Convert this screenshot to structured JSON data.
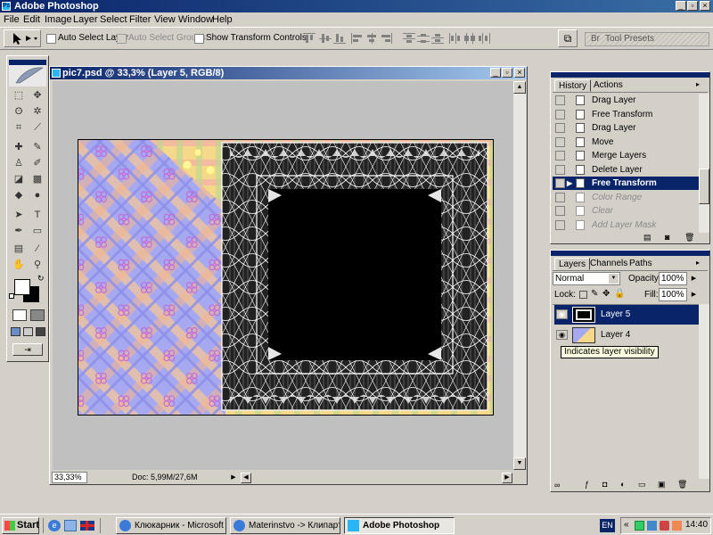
{
  "app": {
    "title": "Adobe Photoshop"
  },
  "menu": [
    "File",
    "Edit",
    "Image",
    "Layer",
    "Select",
    "Filter",
    "View",
    "Window",
    "Help"
  ],
  "options_bar": {
    "auto_select_layer": "Auto Select Layer",
    "auto_select_groups": "Auto Select Groups",
    "show_transform_controls": "Show Transform Controls",
    "tool_presets": "Tool Presets",
    "brushes_tab": "Br"
  },
  "document": {
    "title": "pic7.psd @ 33,3% (Layer 5, RGB/8)",
    "zoom": "33,33%",
    "doc_size": "Doc: 5,99M/27,6M"
  },
  "history": {
    "tabs": [
      "History",
      "Actions"
    ],
    "items": [
      {
        "label": "Drag Layer",
        "state": "normal"
      },
      {
        "label": "Free Transform",
        "state": "normal"
      },
      {
        "label": "Drag Layer",
        "state": "normal"
      },
      {
        "label": "Move",
        "state": "normal"
      },
      {
        "label": "Merge Layers",
        "state": "normal"
      },
      {
        "label": "Delete Layer",
        "state": "normal"
      },
      {
        "label": "Free Transform",
        "state": "selected"
      },
      {
        "label": "Color Range",
        "state": "dimmed"
      },
      {
        "label": "Clear",
        "state": "dimmed"
      },
      {
        "label": "Add Layer Mask",
        "state": "dimmed"
      }
    ]
  },
  "layers": {
    "tabs": [
      "Layers",
      "Channels",
      "Paths"
    ],
    "blend_mode": "Normal",
    "opacity_label": "Opacity:",
    "opacity": "100%",
    "lock_label": "Lock:",
    "fill_label": "Fill:",
    "fill": "100%",
    "items": [
      {
        "name": "Layer 5",
        "selected": true
      },
      {
        "name": "Layer 4",
        "selected": false
      }
    ],
    "tooltip": "Indicates layer visibility"
  },
  "taskbar": {
    "start": "Start",
    "buttons": [
      {
        "label": "Клюкарник - Microsoft I...",
        "active": false
      },
      {
        "label": "Materinstvo -> Клипарт...",
        "active": false
      },
      {
        "label": "Adobe Photoshop",
        "active": true
      }
    ],
    "lang": "EN",
    "clock": "14:40"
  },
  "colors": {
    "titlebar": "#0a246a",
    "selection": "#0a246a",
    "chrome": "#d4d0c8",
    "canvas_bg": "#c0c0c0"
  }
}
